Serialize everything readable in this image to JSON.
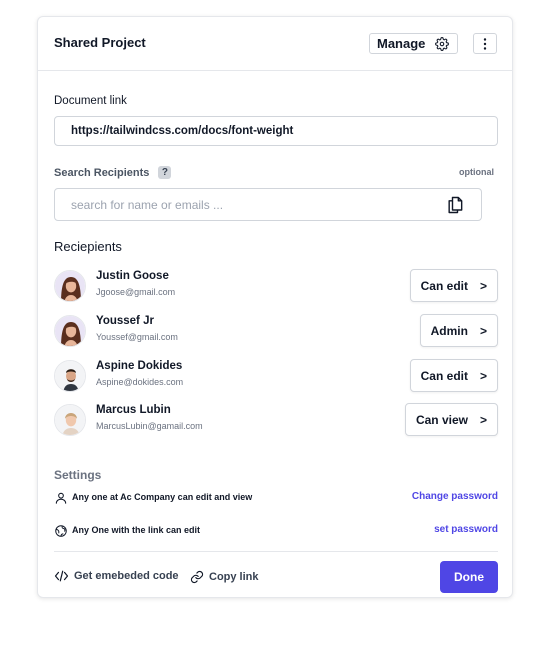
{
  "header": {
    "title": "Shared Project",
    "manage_label": "Manage"
  },
  "document_link": {
    "label": "Document link",
    "value": "https://tailwindcss.com/docs/font-weight"
  },
  "search": {
    "label": "Search Recipients",
    "help_badge": "?",
    "optional_label": "optional",
    "placeholder": "search for name or emails ..."
  },
  "recipients": {
    "title": "Reciepients",
    "items": [
      {
        "name": "Justin Goose",
        "email": "Jgoose@gmail.com",
        "role": "Can edit"
      },
      {
        "name": "Youssef Jr",
        "email": "Youssef@gmail.com",
        "role": "Admin"
      },
      {
        "name": "Aspine Dokides",
        "email": "Aspine@dokides.com",
        "role": "Can edit"
      },
      {
        "name": "Marcus Lubin",
        "email": "MarcusLubin@gamail.com",
        "role": "Can view"
      }
    ],
    "chevron": ">"
  },
  "settings": {
    "title": "Settings",
    "rows": [
      {
        "text": "Any one at Ac Company can edit and view",
        "link": "Change password",
        "icon": "user-icon"
      },
      {
        "text": "Any One with the link can edit",
        "link": "set password",
        "icon": "globe-icon"
      }
    ]
  },
  "footer": {
    "embed_label": "Get emebeded code",
    "copy_label": "Copy link",
    "done_label": "Done"
  },
  "colors": {
    "accent": "#4f46e5",
    "border": "#d1d5db"
  }
}
